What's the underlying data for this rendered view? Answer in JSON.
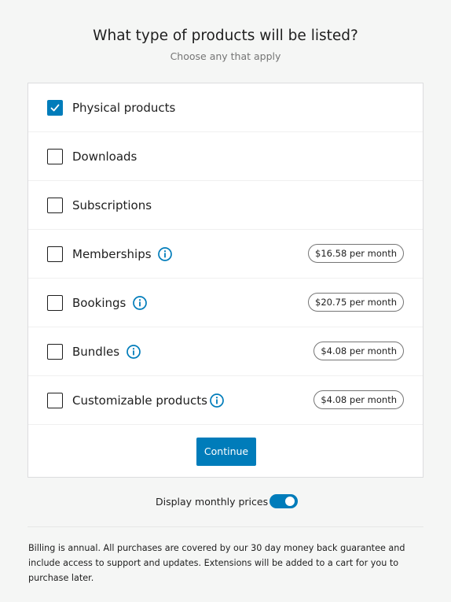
{
  "header": {
    "title": "What type of products will be listed?",
    "subtitle": "Choose any that apply"
  },
  "options": [
    {
      "label": "Physical products",
      "checked": true,
      "info": false,
      "price": ""
    },
    {
      "label": "Downloads",
      "checked": false,
      "info": false,
      "price": ""
    },
    {
      "label": "Subscriptions",
      "checked": false,
      "info": false,
      "price": ""
    },
    {
      "label": "Memberships",
      "checked": false,
      "info": true,
      "price": "$16.58 per month"
    },
    {
      "label": "Bookings",
      "checked": false,
      "info": true,
      "price": "$20.75 per month"
    },
    {
      "label": "Bundles",
      "checked": false,
      "info": true,
      "price": "$4.08 per month"
    },
    {
      "label": "Customizable products",
      "checked": false,
      "info": true,
      "price": "$4.08 per month"
    }
  ],
  "continue_label": "Continue",
  "toggle": {
    "label": "Display monthly prices",
    "on": true
  },
  "billing_note": "Billing is annual. All purchases are covered by our 30 day money back guarantee and include access to support and updates. Extensions will be added to a cart for you to purchase later.",
  "icons": {
    "checkmark": "checkmark-icon",
    "info": "info-icon"
  },
  "colors": {
    "accent": "#007cba",
    "background": "#f5f6f5",
    "card": "#ffffff",
    "text": "#1e1e1e",
    "muted": "#757575"
  }
}
